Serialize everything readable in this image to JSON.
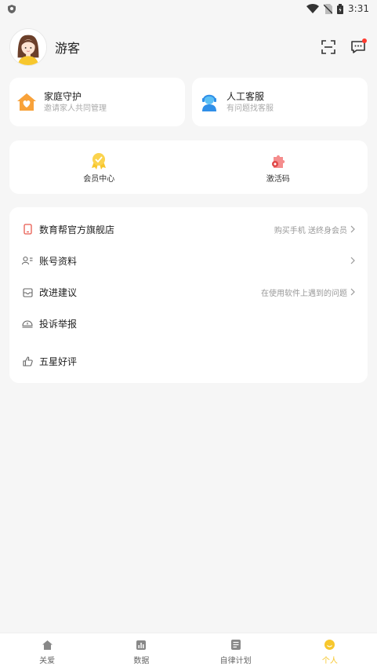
{
  "status_bar": {
    "time": "3:31"
  },
  "header": {
    "username": "游客"
  },
  "quick_cards": [
    {
      "title": "家庭守护",
      "subtitle": "邀请家人共同管理"
    },
    {
      "title": "人工客服",
      "subtitle": "有问题找客服"
    }
  ],
  "features": [
    {
      "label": "会员中心"
    },
    {
      "label": "激活码"
    }
  ],
  "list": [
    {
      "label": "数育帮官方旗舰店",
      "hint": "购买手机 送终身会员"
    },
    {
      "label": "账号资料",
      "hint": ""
    },
    {
      "label": "改进建议",
      "hint": "在使用软件上遇到的问题"
    },
    {
      "label": "投诉举报",
      "hint": ""
    },
    {
      "label": "五星好评",
      "hint": ""
    }
  ],
  "tabs": [
    {
      "label": "关爱"
    },
    {
      "label": "数据"
    },
    {
      "label": "自律计划"
    },
    {
      "label": "个人"
    }
  ],
  "colors": {
    "accent": "#f7c72d",
    "background": "#f6f6f6",
    "notification_dot": "#ff3b30"
  }
}
